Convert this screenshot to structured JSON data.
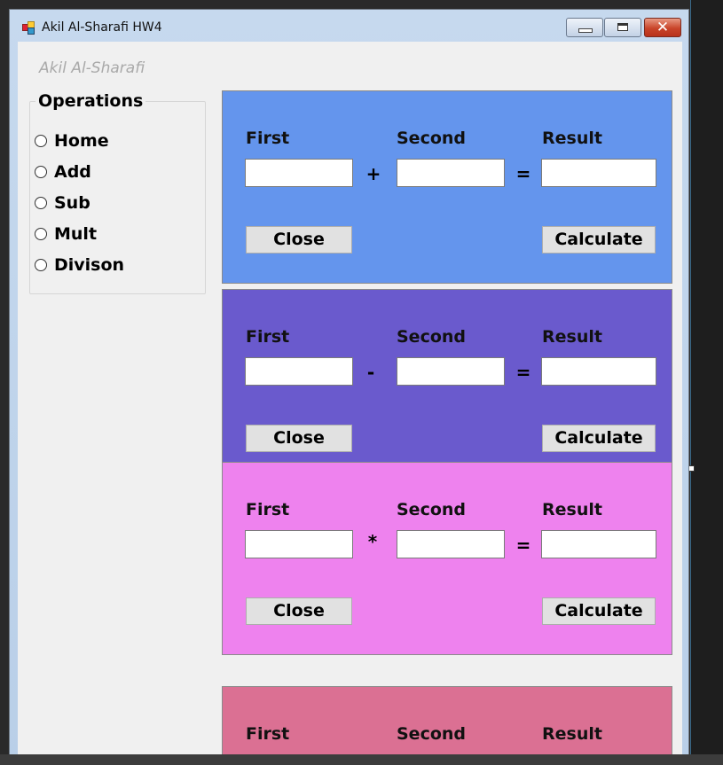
{
  "window": {
    "title": "Akil Al-Sharafi HW4",
    "controls": {
      "minimize": "minimize",
      "maximize": "maximize",
      "close": "✕"
    }
  },
  "author_label": "Akil Al-Sharafi",
  "operations": {
    "title": "Operations",
    "options": [
      {
        "label": "Home"
      },
      {
        "label": "Add"
      },
      {
        "label": "Sub"
      },
      {
        "label": "Mult"
      },
      {
        "label": "Divison"
      }
    ]
  },
  "panels": [
    {
      "operator": "+",
      "color": "#6495ed",
      "first_label": "First",
      "second_label": "Second",
      "result_label": "Result",
      "equals": "=",
      "close_label": "Close",
      "calculate_label": "Calculate",
      "first_value": "",
      "second_value": "",
      "result_value": ""
    },
    {
      "operator": "-",
      "color": "#6a5acd",
      "first_label": "First",
      "second_label": "Second",
      "result_label": "Result",
      "equals": "=",
      "close_label": "Close",
      "calculate_label": "Calculate",
      "first_value": "",
      "second_value": "",
      "result_value": ""
    },
    {
      "operator": "*",
      "color": "#ee82ee",
      "first_label": "First",
      "second_label": "Second",
      "result_label": "Result",
      "equals": "=",
      "close_label": "Close",
      "calculate_label": "Calculate",
      "first_value": "",
      "second_value": "",
      "result_value": ""
    },
    {
      "operator": "",
      "color": "#db7093",
      "first_label": "First",
      "second_label": "Second",
      "result_label": "Result"
    }
  ]
}
